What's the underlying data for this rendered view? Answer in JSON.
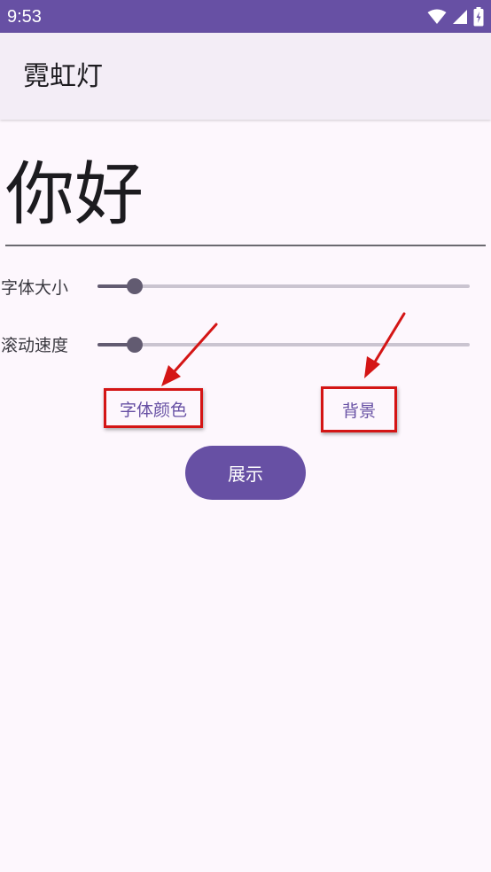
{
  "status_bar": {
    "time": "9:53",
    "icons": [
      "wifi-icon",
      "cellular-signal-icon",
      "battery-charging-icon"
    ]
  },
  "app_bar": {
    "title": "霓虹灯"
  },
  "input": {
    "value": "你好"
  },
  "controls": {
    "font_size_label": "字体大小",
    "font_size_value": 0.1,
    "scroll_speed_label": "滚动速度",
    "scroll_speed_value": 0.1
  },
  "buttons": {
    "font_color_label": "字体颜色",
    "background_label": "背景",
    "show_label": "展示"
  },
  "colors": {
    "primary": "#6750a4",
    "background": "#fdf7fd",
    "app_bar": "#f3edf6",
    "slider_active": "#625b71",
    "slider_inactive": "#cac4d0",
    "annotation": "#d41515"
  }
}
